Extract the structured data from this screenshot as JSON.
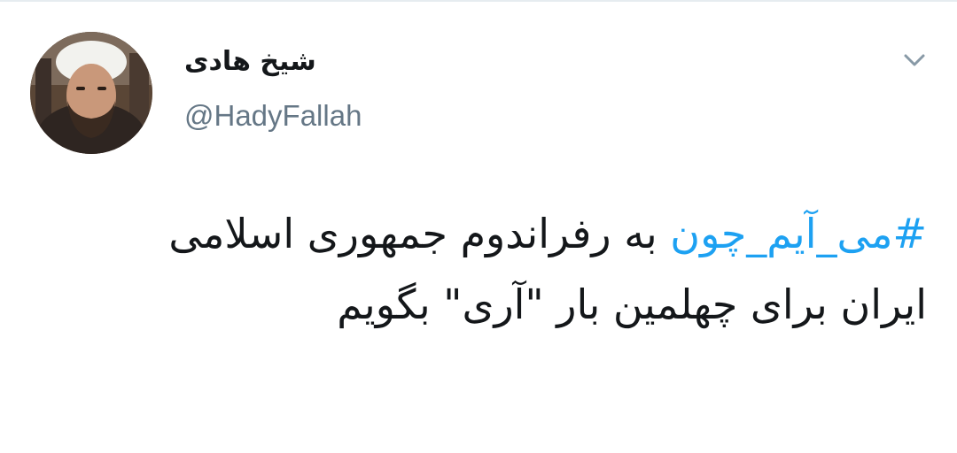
{
  "tweet": {
    "author": {
      "display_name": "شیخ هادی",
      "handle": "@HadyFallah"
    },
    "hashtag": "#می_آیم_چون",
    "body_text": " به رفراندوم جمهوری اسلامی ایران برای چهلمین بار \"آری\" بگویم"
  },
  "icons": {
    "menu_caret": "chevron-down-icon",
    "avatar": "profile-photo"
  },
  "colors": {
    "text": "#14171a",
    "secondary_text": "#657786",
    "hashtag": "#1da1f2",
    "caret": "#8899a6"
  }
}
